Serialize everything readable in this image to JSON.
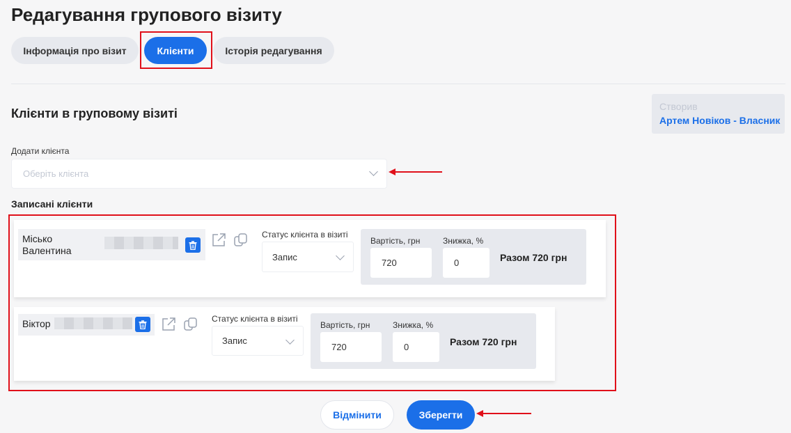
{
  "page": {
    "title": "Редагування групового візиту"
  },
  "tabs": [
    {
      "label": "Інформація про візит"
    },
    {
      "label": "Клієнти"
    },
    {
      "label": "Історія редагування"
    }
  ],
  "section": {
    "title": "Клієнти в груповому візиті"
  },
  "creator": {
    "label": "Створив",
    "name": "Артем Новіков - Власник"
  },
  "add_client": {
    "label": "Додати клієнта",
    "placeholder": "Оберіть клієнта"
  },
  "registered": {
    "label": "Записані клієнти"
  },
  "clients": [
    {
      "name": "Місько Валентина",
      "status_label": "Статус клієнта в візиті",
      "status_value": "Запис",
      "price_label": "Вартість, грн",
      "price_value": "720",
      "discount_label": "Знижка, %",
      "discount_value": "0",
      "total": "Разом 720 грн"
    },
    {
      "name": "Віктор",
      "status_label": "Статус клієнта в візиті",
      "status_value": "Запис",
      "price_label": "Вартість, грн",
      "price_value": "720",
      "discount_label": "Знижка, %",
      "discount_value": "0",
      "total": "Разом 720 грн"
    }
  ],
  "actions": {
    "cancel": "Відмінити",
    "save": "Зберегти"
  },
  "colors": {
    "accent": "#1b6fe8",
    "highlight": "#e0101a",
    "panel": "#e7e9ee"
  },
  "icons": [
    "trash-icon",
    "external-link-icon",
    "copy-icon",
    "chevron-down-icon",
    "arrow-left-icon"
  ]
}
